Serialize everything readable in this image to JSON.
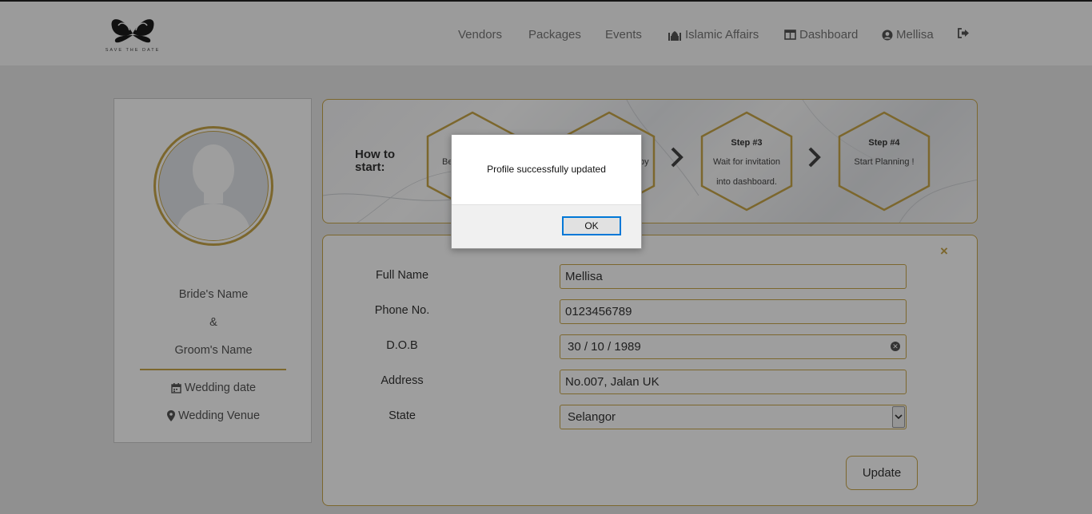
{
  "brand": {
    "tagline": "SAVE THE DATE"
  },
  "nav": {
    "vendors": "Vendors",
    "packages": "Packages",
    "events": "Events",
    "islamic_affairs": "Islamic Affairs",
    "dashboard": "Dashboard",
    "user": "Mellisa"
  },
  "profile_card": {
    "bride_name": "Bride's Name",
    "ampersand": "&",
    "groom_name": "Groom's Name",
    "wedding_date": "Wedding date",
    "wedding_venue": "Wedding Venue"
  },
  "steps": {
    "how_to_line1": "How to",
    "how_to_line2": "start:",
    "step1_desc": "Be",
    "step2_desc": "by",
    "step3_title": "Step #3",
    "step3_desc_line1": "Wait for invitation",
    "step3_desc_line2": "into dashboard.",
    "step4_title": "Step #4",
    "step4_desc": "Start Planning !"
  },
  "form": {
    "full_name_label": "Full Name",
    "full_name_value": "Mellisa",
    "phone_label": "Phone No.",
    "phone_value": "0123456789",
    "dob_label": "D.O.B",
    "dob_value": "30 / 10 / 1989",
    "address_label": "Address",
    "address_value": "No.007, Jalan UK",
    "state_label": "State",
    "state_value": "Selangor",
    "update_button": "Update",
    "close_glyph": "×"
  },
  "dialog": {
    "message": "Profile successfully updated",
    "ok_button": "OK"
  },
  "colors": {
    "accent_gold": "#c9a64a",
    "ok_focus": "#0078d7"
  }
}
